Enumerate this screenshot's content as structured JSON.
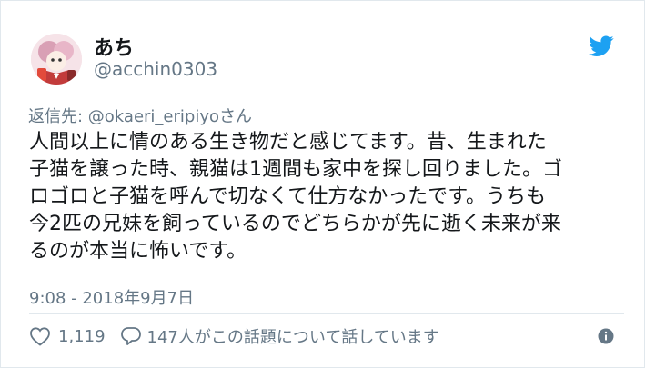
{
  "tweet": {
    "author_name": "あち",
    "author_handle": "@acchin0303",
    "reply_prefix": "返信先: ",
    "reply_mention": "@okaeri_eripiyo",
    "reply_suffix": "さん",
    "text_lines": [
      "人間以上に情のある生き物だと感じてます。昔、生まれた",
      "子猫を譲った時、親猫は1週間も家中を探し回りました。ゴ",
      "ロゴロと子猫を呼んで切なくて仕方なかったです。うちも",
      "今2匹の兄妹を飼っているのでどちらかが先に逝く未来が来",
      "るのが本当に怖いです。"
    ],
    "timestamp": "9:08 - 2018年9月7日",
    "likes": "1,119",
    "discussion": "147人がこの話題について話しています"
  },
  "icons": {
    "logo": "twitter-bird-icon",
    "like": "heart-icon",
    "reply": "speech-bubble-icon",
    "info": "info-icon"
  },
  "colors": {
    "brand": "#1da1f2",
    "text": "#14171a",
    "secondary": "#657786",
    "border": "#e1e8ed"
  }
}
